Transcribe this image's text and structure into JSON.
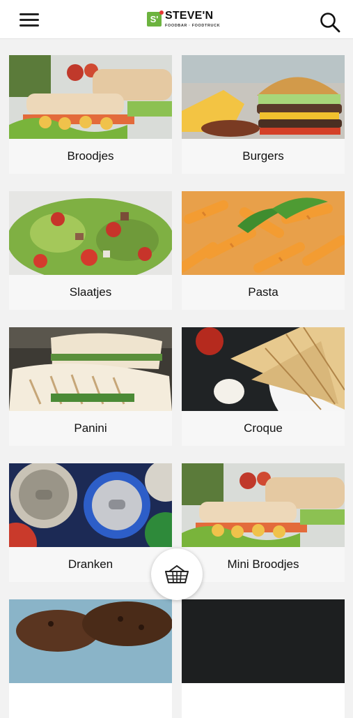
{
  "header": {
    "logo_badge": "S'",
    "logo_name": "STEVE'N",
    "logo_sub": "FOODBAR · FOODTRUCK"
  },
  "categories": [
    {
      "label": "Broodjes",
      "icon": "sandwich-image"
    },
    {
      "label": "Burgers",
      "icon": "burger-image"
    },
    {
      "label": "Slaatjes",
      "icon": "salad-image"
    },
    {
      "label": "Pasta",
      "icon": "pasta-image"
    },
    {
      "label": "Panini",
      "icon": "panini-image"
    },
    {
      "label": "Croque",
      "icon": "croque-image"
    },
    {
      "label": "Dranken",
      "icon": "drinks-image"
    },
    {
      "label": "Mini Broodjes",
      "icon": "mini-sandwich-image"
    },
    {
      "label": "",
      "icon": "cookies-image"
    },
    {
      "label": "",
      "icon": "dark-image"
    }
  ],
  "colors": {
    "brand_green": "#6cb33f",
    "brand_red": "#e53935"
  },
  "basket": {
    "icon": "basket-icon"
  }
}
